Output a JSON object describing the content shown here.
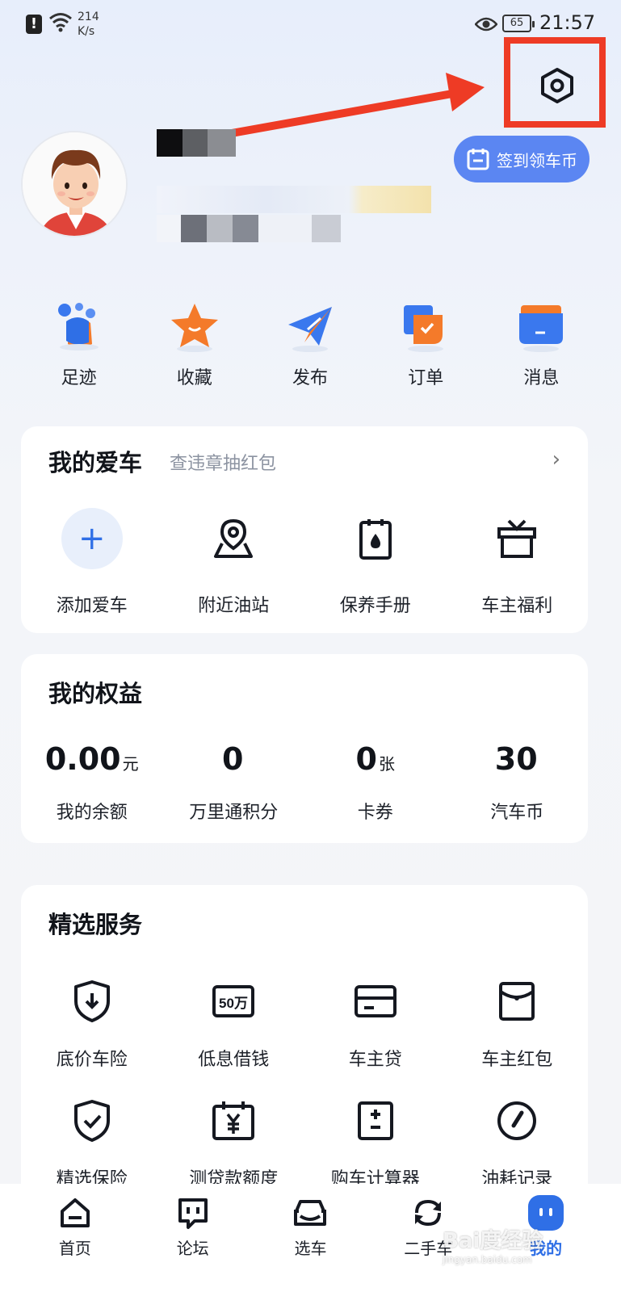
{
  "status_bar": {
    "net_speed_value": "214",
    "net_speed_unit": "K/s",
    "battery": "65",
    "time": "21:57"
  },
  "header": {
    "checkin_label": "签到领车币"
  },
  "quick_actions": [
    {
      "label": "足迹",
      "icon": "footprint-icon"
    },
    {
      "label": "收藏",
      "icon": "star-icon"
    },
    {
      "label": "发布",
      "icon": "paper-plane-icon"
    },
    {
      "label": "订单",
      "icon": "order-icon"
    },
    {
      "label": "消息",
      "icon": "message-icon"
    }
  ],
  "my_car": {
    "title": "我的爱车",
    "subtitle": "查违章抽红包",
    "items": [
      {
        "label": "添加爱车",
        "icon": "plus-icon"
      },
      {
        "label": "附近油站",
        "icon": "map-pin-icon"
      },
      {
        "label": "保养手册",
        "icon": "manual-icon"
      },
      {
        "label": "车主福利",
        "icon": "gift-icon"
      }
    ]
  },
  "rights": {
    "title": "我的权益",
    "stats": [
      {
        "value": "0.00",
        "unit": "元",
        "label": "我的余额"
      },
      {
        "value": "0",
        "unit": "",
        "label": "万里通积分"
      },
      {
        "value": "0",
        "unit": "张",
        "label": "卡券"
      },
      {
        "value": "30",
        "unit": "",
        "label": "汽车币"
      }
    ]
  },
  "services": {
    "title": "精选服务",
    "row1": [
      {
        "label": "底价车险",
        "icon": "shield-download-icon"
      },
      {
        "label": "低息借钱",
        "icon": "fifty-wan-icon",
        "badge": "50万"
      },
      {
        "label": "车主贷",
        "icon": "card-icon"
      },
      {
        "label": "车主红包",
        "icon": "red-envelope-icon"
      }
    ],
    "row2": [
      {
        "label": "精选保险",
        "icon": "shield-check-icon"
      },
      {
        "label": "测贷款额度",
        "icon": "calendar-yen-icon"
      },
      {
        "label": "购车计算器",
        "icon": "calculator-icon"
      },
      {
        "label": "油耗记录",
        "icon": "gauge-icon"
      }
    ]
  },
  "bottom_nav": [
    {
      "label": "首页",
      "icon": "home-icon"
    },
    {
      "label": "论坛",
      "icon": "forum-icon"
    },
    {
      "label": "选车",
      "icon": "car-icon"
    },
    {
      "label": "二手车",
      "icon": "refresh-icon"
    },
    {
      "label": "我的",
      "icon": "me-icon",
      "active": true
    }
  ],
  "watermark": {
    "text": "Bai度经验",
    "sub": "jingyan.baidu.com"
  },
  "colors": {
    "accent": "#2f6fe6",
    "checkin_bg": "#5b86f2",
    "annotation_red": "#ee3b25"
  }
}
